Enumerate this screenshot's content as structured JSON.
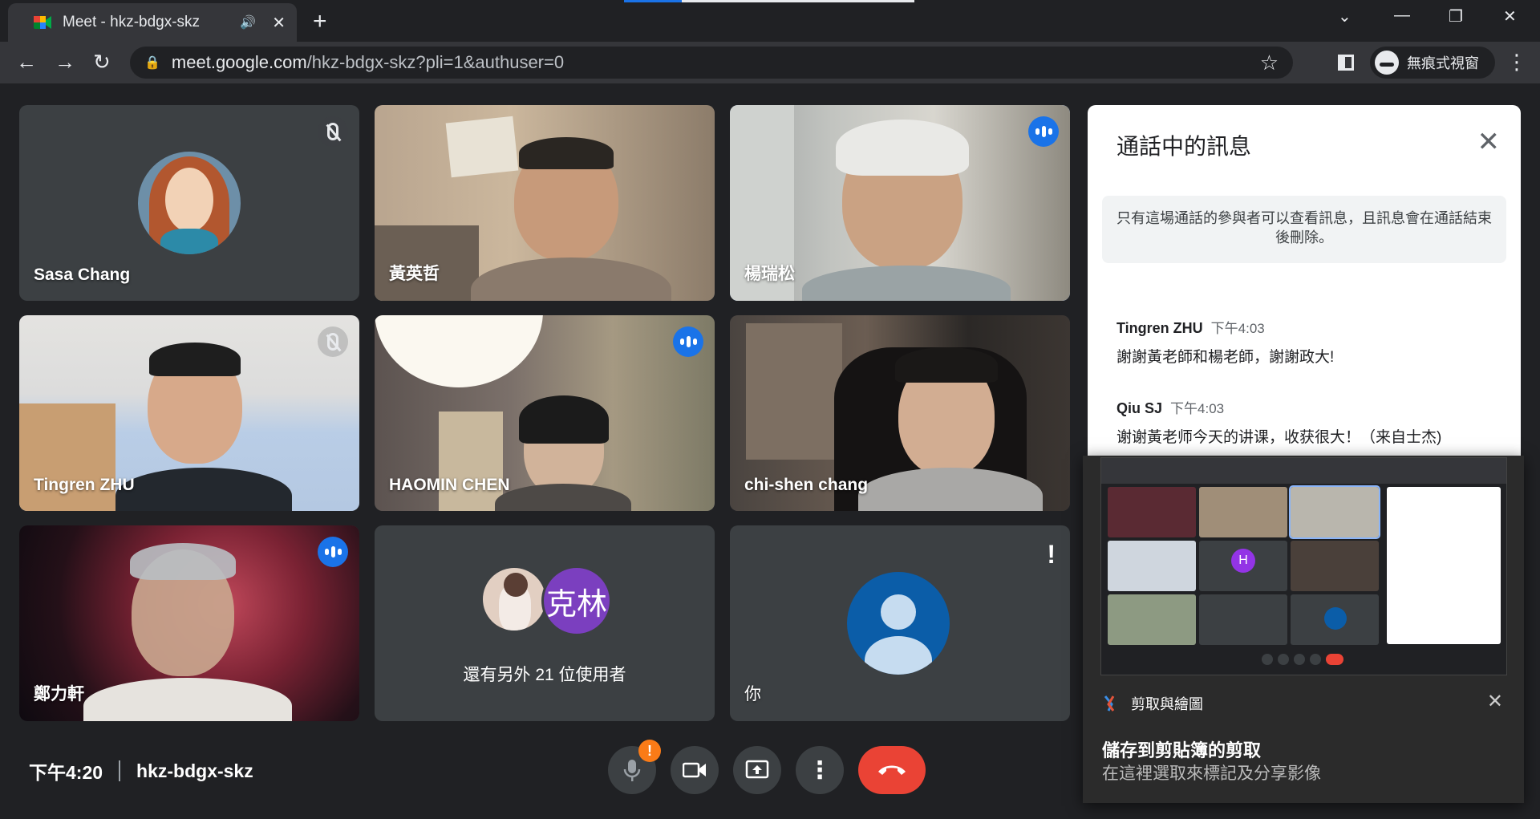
{
  "browser": {
    "tab_title": "Meet - hkz-bdgx-skz",
    "url_host": "meet.google.com",
    "url_path": "/hkz-bdgx-skz?pli=1&authuser=0",
    "incognito_label": "無痕式視窗"
  },
  "tiles": [
    {
      "name": "Sasa Chang",
      "state": "muted"
    },
    {
      "name": "黃英哲",
      "state": "video"
    },
    {
      "name": "楊瑞松",
      "state": "speaking"
    },
    {
      "name": "Tingren ZHU",
      "state": "muted"
    },
    {
      "name": "HAOMIN CHEN",
      "state": "speaking"
    },
    {
      "name": "chi-shen chang",
      "state": "video"
    },
    {
      "name": "鄭力軒",
      "state": "speaking"
    },
    {
      "name": "還有另外 21 位使用者",
      "avatar_text": "克林"
    },
    {
      "name": "你",
      "badge": "!"
    }
  ],
  "meeting": {
    "time": "下午4:20",
    "code": "hkz-bdgx-skz",
    "mic_warning": "!"
  },
  "chat": {
    "title": "通話中的訊息",
    "notice": "只有這場通話的參與者可以查看訊息，且訊息會在通話結束後刪除。",
    "messages": [
      {
        "sender": "Tingren ZHU",
        "time": "下午4:03",
        "text": "謝謝黃老師和楊老師，謝謝政大!"
      },
      {
        "sender": "Qiu SJ",
        "time": "下午4:03",
        "text": "谢谢黃老师今天的讲课，收获很大！（来自士杰)"
      }
    ]
  },
  "snip_toast": {
    "app": "剪取與繪圖",
    "heading": "儲存到剪貼簿的剪取",
    "subtext": "在這裡選取來標記及分享影像",
    "mini_avatar": "H"
  },
  "colors": {
    "accent": "#1a73e8",
    "end_call": "#ea4335",
    "warning": "#fa7b17",
    "active_border": "#8ab4f8"
  }
}
